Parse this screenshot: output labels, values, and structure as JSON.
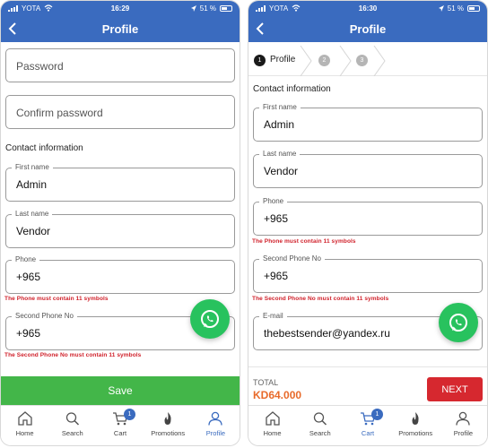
{
  "status_bar": {
    "left": {
      "carrier": "YOTA",
      "time": "16:29",
      "battery": "51 %"
    },
    "right": {
      "carrier": "YOTA",
      "time": "16:30",
      "battery": "51 %"
    }
  },
  "nav": {
    "title": "Profile"
  },
  "left": {
    "password_placeholder": "Password",
    "confirm_password_placeholder": "Confirm password",
    "section_title": "Contact information",
    "first_name": {
      "label": "First name",
      "value": "Admin"
    },
    "last_name": {
      "label": "Last name",
      "value": "Vendor"
    },
    "phone": {
      "label": "Phone",
      "value": "+965",
      "error": "The Phone must contain 11 symbols"
    },
    "second_phone": {
      "label": "Second Phone No",
      "value": "+965",
      "error": "The Second Phone No must contain 11 symbols"
    },
    "save_label": "Save"
  },
  "right": {
    "steps": [
      {
        "number": "1",
        "label": "Profile"
      },
      {
        "number": "2"
      },
      {
        "number": "3"
      }
    ],
    "section_title": "Contact information",
    "first_name": {
      "label": "First name",
      "value": "Admin"
    },
    "last_name": {
      "label": "Last name",
      "value": "Vendor"
    },
    "phone": {
      "label": "Phone",
      "value": "+965",
      "error": "The Phone must contain 11 symbols"
    },
    "second_phone": {
      "label": "Second Phone No",
      "value": "+965",
      "error": "The Second Phone No must contain 11 symbols"
    },
    "email": {
      "label": "E-mail",
      "value": "thebestsender@yandex.ru"
    },
    "total_label": "TOTAL",
    "total_value": "KD64.000",
    "next_label": "NEXT"
  },
  "tabs": {
    "home": "Home",
    "search": "Search",
    "cart": "Cart",
    "cart_badge": "1",
    "promotions": "Promotions",
    "profile": "Profile"
  },
  "colors": {
    "header_blue": "#3a6bbf",
    "save_green": "#43b649",
    "error_red": "#d0202a",
    "whatsapp_green": "#28c25e",
    "total_orange": "#e86a2a",
    "next_red": "#d6282f"
  }
}
